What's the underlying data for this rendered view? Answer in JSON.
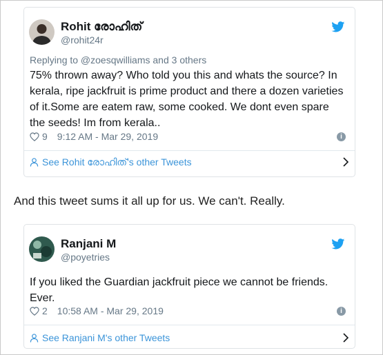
{
  "colors": {
    "link": "#3b94d9",
    "twitter_blue": "#1da1f2",
    "muted": "#657786"
  },
  "tweet1": {
    "name": "Rohit രോഹിത്",
    "handle": "@rohit24r",
    "reply_to": "Replying to @zoesqwilliams and 3 others",
    "text": "75% thrown away? Who told you this and whats the source? In kerala, ripe jackfruit is prime product and there a dozen varieties of it.Some are eatem raw, some cooked. We dont even spare the seeds! Im from kerala..",
    "likes": "9",
    "timestamp": "9:12 AM - Mar 29, 2019",
    "footer_link": "See Rohit രോഹിത്'s other Tweets",
    "icons": {
      "avatar": "avatar",
      "logo": "twitter-bird-icon",
      "like": "heart-icon",
      "info": "info-icon",
      "profile": "person-icon",
      "next": "chevron-right-icon"
    }
  },
  "caption": "And this tweet sums it all up for us. We can't. Really.",
  "tweet2": {
    "name": "Ranjani M",
    "handle": "@poyetries",
    "text": "If you liked the Guardian jackfruit piece we cannot be friends. Ever.",
    "likes": "2",
    "timestamp": "10:58 AM - Mar 29, 2019",
    "footer_link": "See Ranjani M's other Tweets",
    "icons": {
      "avatar": "avatar",
      "logo": "twitter-bird-icon",
      "like": "heart-icon",
      "info": "info-icon",
      "profile": "person-icon",
      "next": "chevron-right-icon"
    }
  }
}
